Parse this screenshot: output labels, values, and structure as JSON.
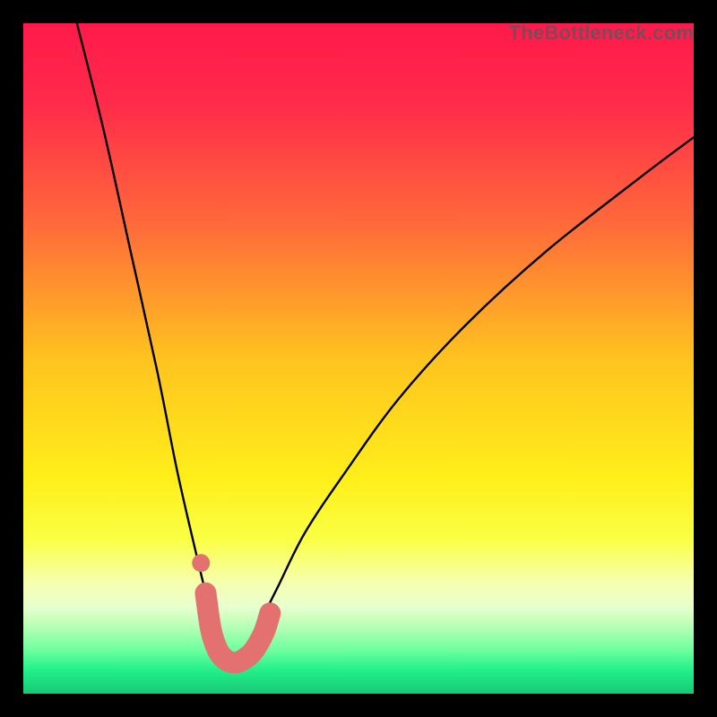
{
  "watermark": "TheBottleneck.com",
  "chart_data": {
    "type": "line",
    "title": "",
    "xlabel": "",
    "ylabel": "",
    "xlim": [
      0,
      100
    ],
    "ylim": [
      0,
      100
    ],
    "optimum_x": 31.5,
    "series": [
      {
        "name": "bottleneck-curve",
        "x": [
          8,
          12,
          16,
          20,
          23,
          26,
          28,
          30,
          31.5,
          33,
          35,
          38,
          42,
          48,
          56,
          66,
          78,
          92,
          100
        ],
        "y": [
          100,
          84,
          66,
          48,
          33,
          20,
          12,
          6,
          4,
          6,
          10,
          16,
          24,
          33,
          44,
          55,
          66,
          77,
          83
        ]
      }
    ],
    "marker_band": {
      "name": "optimum-marker",
      "x": [
        27.2,
        28,
        29,
        30,
        31,
        32,
        33,
        34,
        35,
        36,
        36.8
      ],
      "y": [
        15,
        9.5,
        6.5,
        5.2,
        4.7,
        4.7,
        5.2,
        6.0,
        7.4,
        9.4,
        12.0
      ]
    },
    "marker_dot": {
      "x": 26.5,
      "y": 19.5
    },
    "background_gradient": [
      {
        "stop": 0.0,
        "color": "#ff1a4b"
      },
      {
        "stop": 0.12,
        "color": "#ff2b4a"
      },
      {
        "stop": 0.3,
        "color": "#ff6a3a"
      },
      {
        "stop": 0.5,
        "color": "#ffc31f"
      },
      {
        "stop": 0.68,
        "color": "#ffef1a"
      },
      {
        "stop": 0.77,
        "color": "#faff45"
      },
      {
        "stop": 0.835,
        "color": "#f6ffb0"
      },
      {
        "stop": 0.87,
        "color": "#e8ffce"
      },
      {
        "stop": 0.9,
        "color": "#b6ffb6"
      },
      {
        "stop": 0.935,
        "color": "#6dff9e"
      },
      {
        "stop": 0.965,
        "color": "#22f08a"
      },
      {
        "stop": 1.0,
        "color": "#17c877"
      }
    ]
  }
}
